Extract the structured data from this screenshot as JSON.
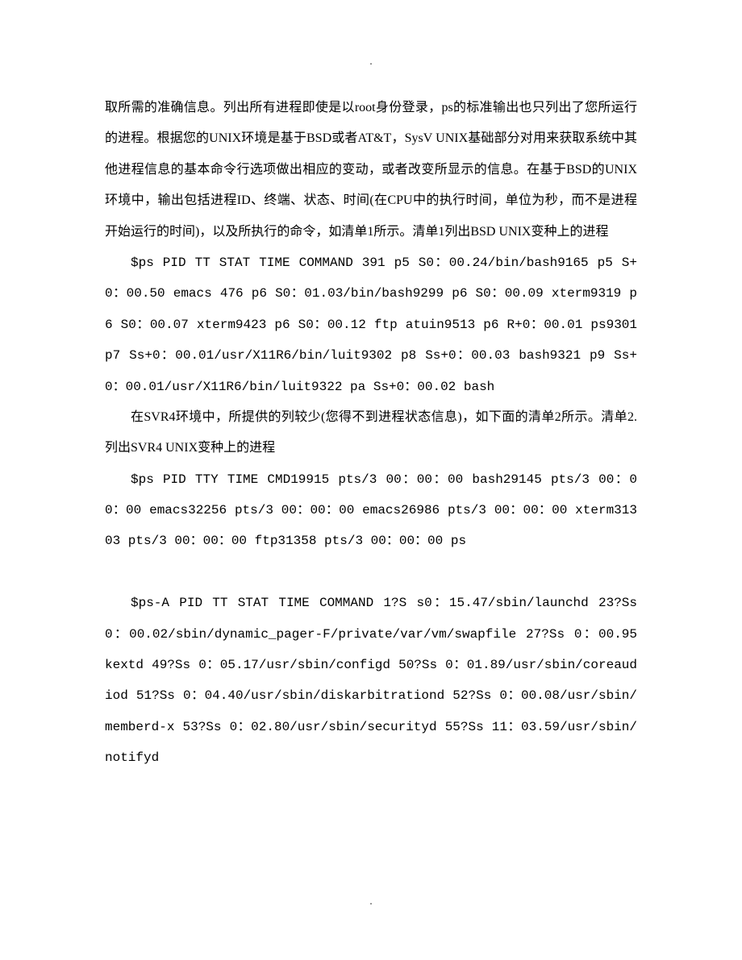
{
  "marker": ".",
  "p1": "取所需的准确信息。列出所有进程即使是以root身份登录，ps的标准输出也只列出了您所运行的进程。根据您的UNIX环境是基于BSD或者AT&T，SysV UNIX基础部分对用来获取系统中其他进程信息的基本命令行选项做出相应的变动，或者改变所显示的信息。在基于BSD的UNIX环境中，输出包括进程ID、终端、状态、时间(在CPU中的执行时间，单位为秒，而不是进程开始运行的时间)，以及所执行的命令，如清单1所示。清单1列出BSD UNIX变种上的进程",
  "c1a": "$ps PID TT STAT TIME COMMAND 391 p5 S0：00.24/bin/bash9165 p5 S+0：00.50 emacs 476 p6 S0：01.03/bin/bash9299 p6 S0：00.09 xterm9319 p6 S0：00.07 xterm9423 p6 S0：00.12 ftp atuin9513 p6 R+0：00.01 ps9301 p7 Ss+0：00.01/usr/X11R6/bin/luit9302 p8 Ss+0：00.03 bash9321 p9 Ss+0：00.01/usr/X11R6/bin/luit9322 pa Ss+0：00.02 bash",
  "p2": "在SVR4环境中，所提供的列较少(您得不到进程状态信息)，如下面的清单2所示。清单2.列出SVR4 UNIX变种上的进程",
  "c2a": "$ps PID TTY TIME CMD19915 pts/3 00：00：00 bash29145 pts/3 00：00：00 emacs32256 pts/3 00：00：00 emacs26986 pts/3 00：00：00 xterm31303 pts/3 00：00：00 ftp31358 pts/3 00：00：00 ps",
  "c3a": "$ps-A PID TT STAT TIME COMMAND 1?S s0：15.47/sbin/launchd 23?Ss 0：00.02/sbin/dynamic_pager-F/private/var/vm/swapfile 27?Ss 0：00.95 kextd 49?Ss 0：05.17/usr/sbin/configd 50?Ss 0：01.89/usr/sbin/coreaudiod 51?Ss 0：04.40/usr/sbin/diskarbitrationd 52?Ss 0：00.08/usr/sbin/memberd-x 53?Ss 0：02.80/usr/sbin/securityd 55?Ss 11：03.59/usr/sbin/notifyd"
}
